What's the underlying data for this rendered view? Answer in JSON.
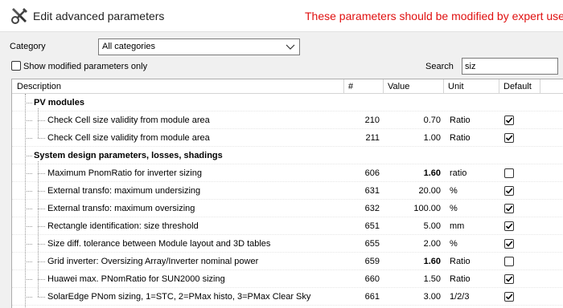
{
  "window": {
    "title": "Edit advanced parameters",
    "warning": "These parameters should be modified by expert users o",
    "warning_color": "#e01010"
  },
  "filters": {
    "category_label": "Category",
    "category_value": "All categories",
    "show_modified_label": "Show modified parameters only",
    "show_modified_checked": false,
    "search_label": "Search",
    "search_value": "siz"
  },
  "table": {
    "columns": [
      "Description",
      "#",
      "Value",
      "Unit",
      "Default"
    ],
    "rows": [
      {
        "type": "group",
        "description": "PV modules"
      },
      {
        "type": "item",
        "description": "Check Cell size validity from module area",
        "num": "210",
        "value": "0.70",
        "unit": "Ratio",
        "default": true,
        "bold": false
      },
      {
        "type": "item",
        "description": "Check Cell size validity from module area",
        "num": "211",
        "value": "1.00",
        "unit": "Ratio",
        "default": true,
        "bold": false
      },
      {
        "type": "group",
        "description": "System design parameters, losses, shadings"
      },
      {
        "type": "item",
        "description": "Maximum PnomRatio for inverter sizing",
        "num": "606",
        "value": "1.60",
        "unit": "ratio",
        "default": false,
        "bold": true
      },
      {
        "type": "item",
        "description": "External transfo: maximum undersizing",
        "num": "631",
        "value": "20.00",
        "unit": "%",
        "default": true,
        "bold": false
      },
      {
        "type": "item",
        "description": "External transfo: maximum oversizing",
        "num": "632",
        "value": "100.00",
        "unit": "%",
        "default": true,
        "bold": false
      },
      {
        "type": "item",
        "description": "Rectangle identification: size threshold",
        "num": "651",
        "value": "5.00",
        "unit": "mm",
        "default": true,
        "bold": false
      },
      {
        "type": "item",
        "description": "Size diff. tolerance between Module layout and 3D tables",
        "num": "655",
        "value": "2.00",
        "unit": "%",
        "default": true,
        "bold": false
      },
      {
        "type": "item",
        "description": "Grid inverter: Oversizing Array/Inverter nominal power",
        "num": "659",
        "value": "1.60",
        "unit": "Ratio",
        "default": false,
        "bold": true
      },
      {
        "type": "item",
        "description": "Huawei max. PNomRatio for SUN2000 sizing",
        "num": "660",
        "value": "1.50",
        "unit": "Ratio",
        "default": true,
        "bold": false
      },
      {
        "type": "item",
        "description": "SolarEdge PNom sizing, 1=STC, 2=PMax histo, 3=PMax Clear Sky",
        "num": "661",
        "value": "3.00",
        "unit": "1/2/3",
        "default": true,
        "bold": false
      }
    ]
  }
}
